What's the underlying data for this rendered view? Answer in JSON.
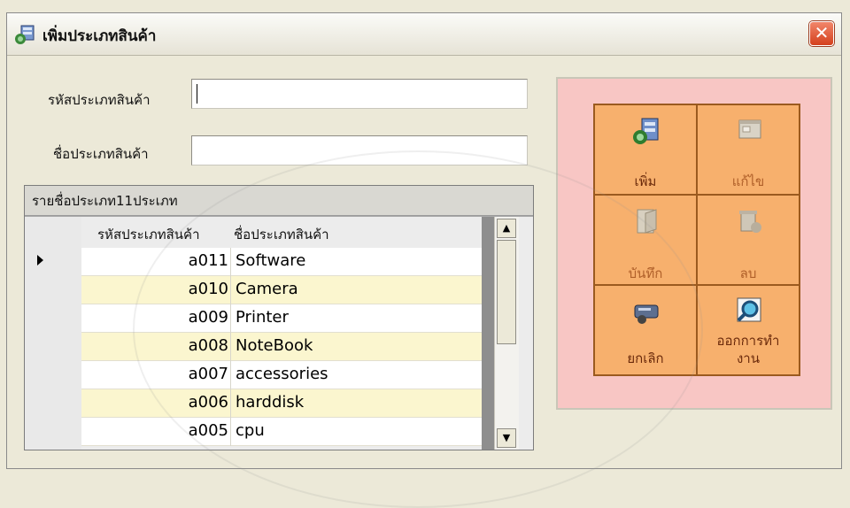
{
  "window": {
    "title": "เพิ่มประเภทสินค้า",
    "close_label": "✕"
  },
  "form": {
    "code_label": "รหัสประเภทสินค้า",
    "code_value": "",
    "name_label": "ชื่อประเภทสินค้า",
    "name_value": ""
  },
  "grid": {
    "caption": "รายชื่อประเภท11ประเภท",
    "columns": [
      "รหัสประเภทสินค้า",
      "ชื่อประเภทสินค้า"
    ],
    "rows": [
      {
        "code": "a011",
        "name": "Software"
      },
      {
        "code": "a010",
        "name": "Camera"
      },
      {
        "code": "a009",
        "name": "Printer"
      },
      {
        "code": "a008",
        "name": "NoteBook"
      },
      {
        "code": "a007",
        "name": "accessories"
      },
      {
        "code": "a006",
        "name": "harddisk"
      },
      {
        "code": "a005",
        "name": "cpu"
      }
    ],
    "scroll_up": "▲",
    "scroll_down": "▼"
  },
  "buttons": {
    "add": "เพิ่ม",
    "edit": "แก้ไข",
    "save": "บันทึก",
    "delete": "ลบ",
    "cancel": "ยกเลิก",
    "exit_line1": "ออกการทำ",
    "exit_line2": "งาน"
  },
  "colors": {
    "panel_bg": "#f8c6c4",
    "button_bg": "#f7b06d",
    "button_text": "#6b2a0b",
    "button_text_disabled": "#b0602a",
    "row_alt": "#fbf6cf"
  }
}
